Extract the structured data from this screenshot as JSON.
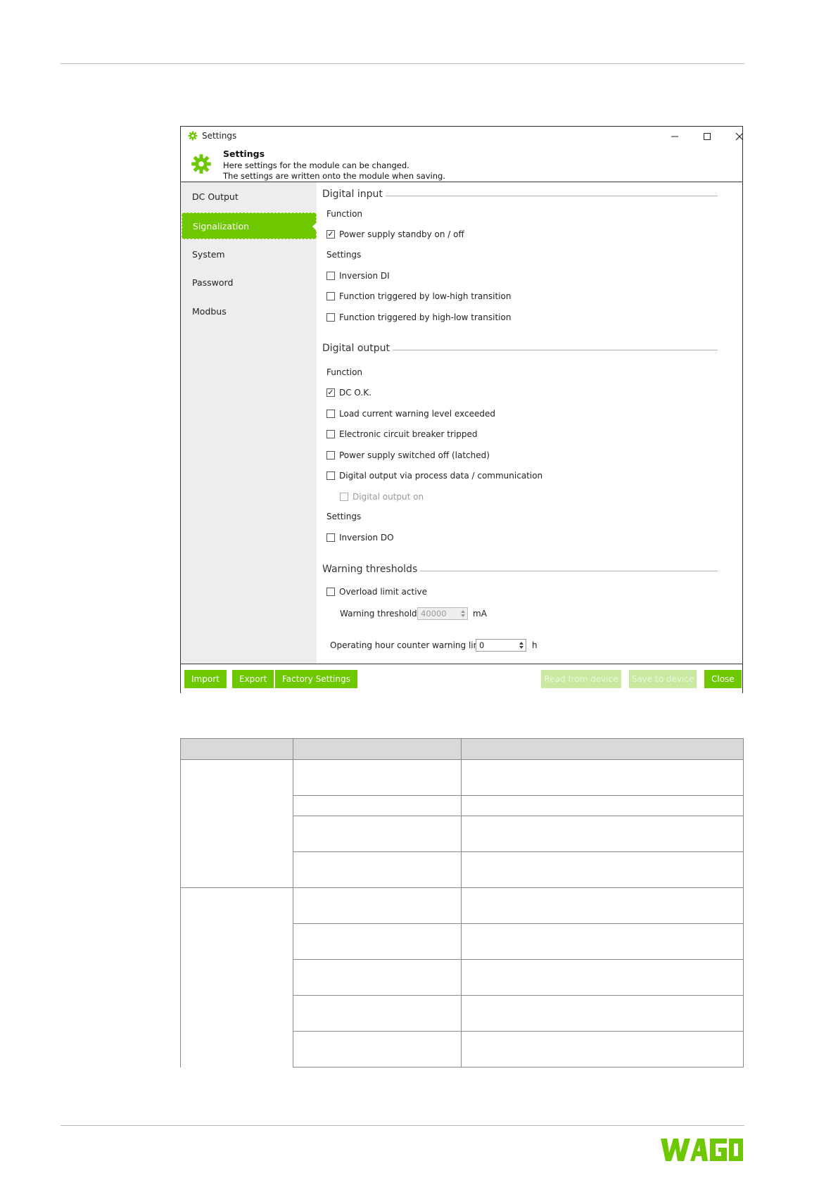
{
  "dialog": {
    "title": "Settings",
    "header": {
      "title": "Settings",
      "line1": "Here settings for the module can be changed.",
      "line2": "The settings are written onto the module when saving."
    },
    "sidebar": {
      "items": [
        {
          "label": "DC Output",
          "active": false
        },
        {
          "label": "Signalization",
          "active": true
        },
        {
          "label": "System",
          "active": false
        },
        {
          "label": "Password",
          "active": false
        },
        {
          "label": "Modbus",
          "active": false
        }
      ]
    },
    "digital_input": {
      "title": "Digital input",
      "function_label": "Function",
      "power_standby": {
        "label": "Power supply standby on / off",
        "checked": true
      },
      "settings_label": "Settings",
      "inversion_di": {
        "label": "Inversion DI",
        "checked": false
      },
      "low_high": {
        "label": "Function triggered by low-high transition",
        "checked": false
      },
      "high_low": {
        "label": "Function triggered by high-low transition",
        "checked": false
      }
    },
    "digital_output": {
      "title": "Digital output",
      "function_label": "Function",
      "dc_ok": {
        "label": "DC O.K.",
        "checked": true
      },
      "load_current": {
        "label": "Load current warning level exceeded",
        "checked": false
      },
      "breaker": {
        "label": "Electronic circuit breaker tripped",
        "checked": false
      },
      "switched_off": {
        "label": "Power supply switched off (latched)",
        "checked": false
      },
      "via_process": {
        "label": "Digital output via process data / communication",
        "checked": false
      },
      "output_on": {
        "label": "Digital output on",
        "checked": false,
        "disabled": true
      },
      "settings_label": "Settings",
      "inversion_do": {
        "label": "Inversion DO",
        "checked": false
      }
    },
    "warning_thresholds": {
      "title": "Warning thresholds",
      "overload": {
        "label": "Overload limit active",
        "checked": false
      },
      "threshold_label": "Warning threshold",
      "threshold_value": "40000",
      "threshold_unit": "mA",
      "hour_label": "Operating hour counter warning limit",
      "hour_value": "0",
      "hour_unit": "h"
    },
    "footer": {
      "import": "Import",
      "export": "Export",
      "factory": "Factory Settings",
      "read": "Read from device",
      "save": "Save to device",
      "close": "Close"
    }
  },
  "colors": {
    "accent": "#6ec800",
    "accent_disabled": "#c9e9a0",
    "sidebar_bg": "#ededed",
    "table_header_bg": "#d9d9d9"
  },
  "icons": {
    "window": "gear-icon",
    "header": "gear-icon",
    "minimize": "minimize-icon",
    "maximize": "maximize-icon",
    "close": "close-icon"
  }
}
